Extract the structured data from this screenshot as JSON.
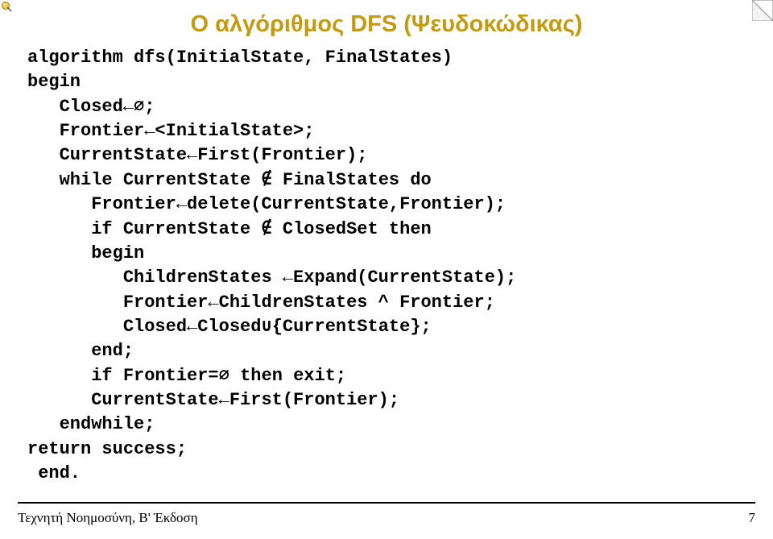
{
  "title": "Ο αλγόριθμος DFS (Ψευδοκώδικας)",
  "code": {
    "l1": "algorithm dfs(InitialState, FinalStates)",
    "l2": "begin",
    "l3": "   Closed←∅;",
    "l4": "   Frontier←<InitialState>;",
    "l5": "   CurrentState←First(Frontier);",
    "l6": "   while CurrentState ∉ FinalStates do",
    "l7": "      Frontier←delete(CurrentState,Frontier);",
    "l8": "      if CurrentState ∉ ClosedSet then",
    "l9": "      begin",
    "l10": "         ChildrenStates ←Expand(CurrentState);",
    "l11": "         Frontier←ChildrenStates ^ Frontier;",
    "l12": "         Closed←Closed∪{CurrentState};",
    "l13": "      end;",
    "l14": "      if Frontier=∅ then exit;",
    "l15": "      CurrentState←First(Frontier);",
    "l16": "   endwhile;",
    "l17": "return success;",
    "l18": " end."
  },
  "footer": {
    "left": "Τεχνητή Νοημοσύνη, B' Έκδοση",
    "right": "7"
  }
}
